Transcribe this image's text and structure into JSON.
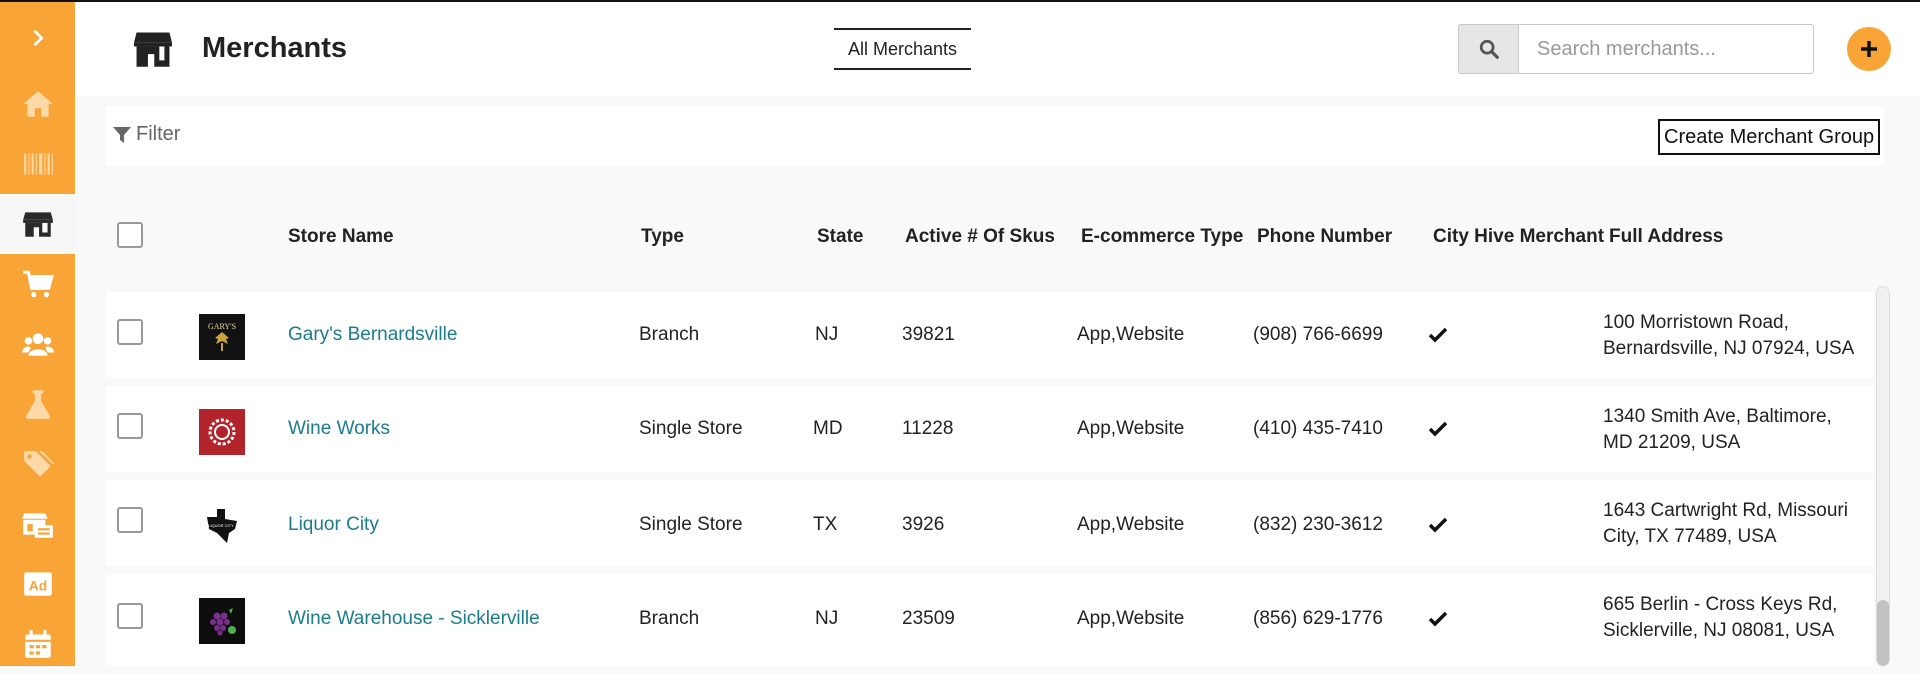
{
  "sidebar": {
    "toggle_icon": "chevron-right-icon",
    "items": [
      {
        "icon": "home-icon",
        "active": false
      },
      {
        "icon": "barcode-icon",
        "active": false
      },
      {
        "icon": "store-icon",
        "active": true
      },
      {
        "icon": "cart-icon",
        "active": false
      },
      {
        "icon": "users-icon",
        "active": false
      },
      {
        "icon": "flask-icon",
        "active": false
      },
      {
        "icon": "tags-icon",
        "active": false
      },
      {
        "icon": "store-settings-icon",
        "active": false
      },
      {
        "icon": "ad-icon",
        "active": false,
        "label": "Ad"
      },
      {
        "icon": "calendar-icon",
        "active": false
      }
    ]
  },
  "header": {
    "title": "Merchants",
    "tab": "All Merchants",
    "search_placeholder": "Search merchants...",
    "add_icon": "plus-icon"
  },
  "filter": {
    "label": "Filter",
    "create_group": "Create Merchant Group"
  },
  "table": {
    "columns": [
      "Store Name",
      "Type",
      "State",
      "Active # Of Skus",
      "E-commerce Type",
      "Phone Number",
      "City Hive Merchant",
      "Full Address"
    ],
    "rows": [
      {
        "store_name": "Gary's Bernardsville",
        "logo_text": "GARY'S",
        "type": "Branch",
        "state": "NJ",
        "skus": "39821",
        "ecommerce": "App,Website",
        "phone": "(908) 766-6699",
        "city_hive": true,
        "address": "100 Morristown Road, Bernardsville, NJ 07924, USA"
      },
      {
        "store_name": "Wine Works",
        "logo_text": "",
        "type": "Single Store",
        "state": "MD",
        "skus": "11228",
        "ecommerce": "App,Website",
        "phone": "(410) 435-7410",
        "city_hive": true,
        "address": "1340 Smith Ave, Baltimore, MD 21209, USA"
      },
      {
        "store_name": "Liquor City",
        "logo_text": "LIQUOR CITY",
        "type": "Single Store",
        "state": "TX",
        "skus": "3926",
        "ecommerce": "App,Website",
        "phone": "(832) 230-3612",
        "city_hive": true,
        "address": "1643 Cartwright Rd, Missouri City, TX 77489, USA"
      },
      {
        "store_name": "Wine Warehouse - Sicklerville",
        "logo_text": "",
        "type": "Branch",
        "state": "NJ",
        "skus": "23509",
        "ecommerce": "App,Website",
        "phone": "(856) 629-1776",
        "city_hive": true,
        "address": "665 Berlin - Cross Keys Rd, Sicklerville, NJ 08081, USA"
      }
    ]
  },
  "colors": {
    "accent": "#f8a436",
    "link": "#1a7d8c"
  }
}
